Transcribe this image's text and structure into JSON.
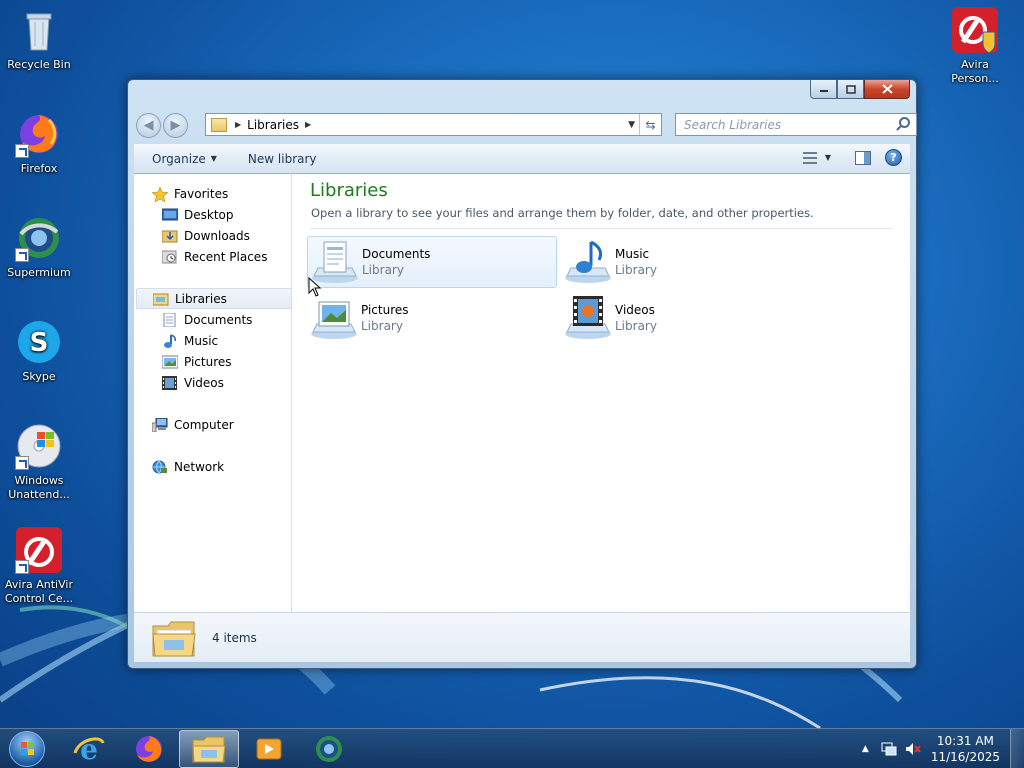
{
  "desktop": {
    "icons": [
      {
        "label": "Recycle Bin"
      },
      {
        "label": "Firefox"
      },
      {
        "label": "Supermium"
      },
      {
        "label": "Skype"
      },
      {
        "label": "Windows Unattend..."
      },
      {
        "label": "Avira AntiVir Control Ce..."
      },
      {
        "label": "Avira Person..."
      }
    ]
  },
  "window": {
    "address": {
      "crumb": "Libraries"
    },
    "search": {
      "placeholder": "Search Libraries"
    },
    "toolbar": {
      "organize": "Organize",
      "new_library": "New library"
    },
    "nav": {
      "favorites": "Favorites",
      "desktop": "Desktop",
      "downloads": "Downloads",
      "recent_places": "Recent Places",
      "libraries": "Libraries",
      "documents": "Documents",
      "music": "Music",
      "pictures": "Pictures",
      "videos": "Videos",
      "computer": "Computer",
      "network": "Network"
    },
    "content": {
      "title": "Libraries",
      "subtitle": "Open a library to see your files and arrange them by folder, date, and other properties.",
      "tiles": [
        {
          "name": "Documents",
          "type": "Library"
        },
        {
          "name": "Music",
          "type": "Library"
        },
        {
          "name": "Pictures",
          "type": "Library"
        },
        {
          "name": "Videos",
          "type": "Library"
        }
      ]
    },
    "status": {
      "items": "4 items"
    }
  },
  "taskbar": {
    "clock": {
      "time": "10:31 AM",
      "date": "11/16/2025"
    }
  },
  "colors": {
    "accent_title": "#1e7b1e",
    "selection": "#e5f0fb"
  }
}
